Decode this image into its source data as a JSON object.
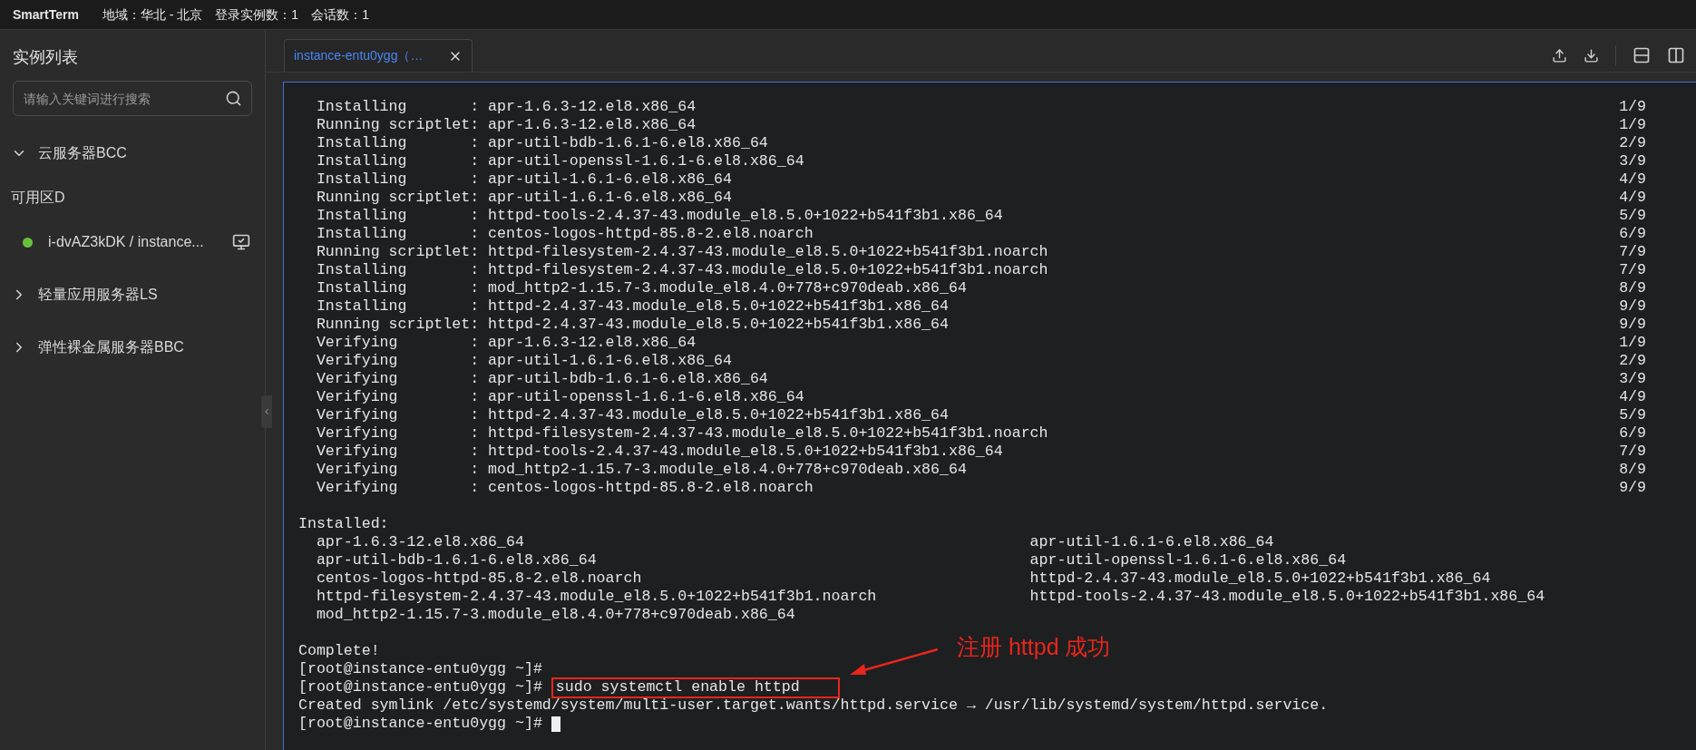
{
  "top_bar": {
    "app_name": "SmartTerm",
    "info": [
      "地域：华北 - 北京",
      "登录实例数：1",
      "会话数：1"
    ]
  },
  "sidebar": {
    "title": "实例列表",
    "search": {
      "placeholder": "请输入关键词进行搜索"
    },
    "groups": [
      {
        "label": "云服务器BCC",
        "expanded": true,
        "children": [
          {
            "label": "可用区D",
            "children": [
              {
                "label": "i-dvAZ3kDK / instance...",
                "color": "#67c23a"
              }
            ]
          }
        ]
      },
      {
        "label": "轻量应用服务器LS",
        "expanded": false
      },
      {
        "label": "弹性裸金属服务器BBC",
        "expanded": false
      }
    ]
  },
  "tabs": [
    {
      "label": "instance-entu0ygg（…",
      "selected": true
    }
  ],
  "terminal": {
    "lines": [
      {
        "kind": "step",
        "text": "  Installing       : apr-1.6.3-12.el8.x86_64",
        "progress": "1/9"
      },
      {
        "kind": "step",
        "text": "  Running scriptlet: apr-1.6.3-12.el8.x86_64",
        "progress": "1/9"
      },
      {
        "kind": "step",
        "text": "  Installing       : apr-util-bdb-1.6.1-6.el8.x86_64",
        "progress": "2/9"
      },
      {
        "kind": "step",
        "text": "  Installing       : apr-util-openssl-1.6.1-6.el8.x86_64",
        "progress": "3/9"
      },
      {
        "kind": "step",
        "text": "  Installing       : apr-util-1.6.1-6.el8.x86_64",
        "progress": "4/9"
      },
      {
        "kind": "step",
        "text": "  Running scriptlet: apr-util-1.6.1-6.el8.x86_64",
        "progress": "4/9"
      },
      {
        "kind": "step",
        "text": "  Installing       : httpd-tools-2.4.37-43.module_el8.5.0+1022+b541f3b1.x86_64",
        "progress": "5/9"
      },
      {
        "kind": "step",
        "text": "  Installing       : centos-logos-httpd-85.8-2.el8.noarch",
        "progress": "6/9"
      },
      {
        "kind": "step",
        "text": "  Running scriptlet: httpd-filesystem-2.4.37-43.module_el8.5.0+1022+b541f3b1.noarch",
        "progress": "7/9"
      },
      {
        "kind": "step",
        "text": "  Installing       : httpd-filesystem-2.4.37-43.module_el8.5.0+1022+b541f3b1.noarch",
        "progress": "7/9"
      },
      {
        "kind": "step",
        "text": "  Installing       : mod_http2-1.15.7-3.module_el8.4.0+778+c970deab.x86_64",
        "progress": "8/9"
      },
      {
        "kind": "step",
        "text": "  Installing       : httpd-2.4.37-43.module_el8.5.0+1022+b541f3b1.x86_64",
        "progress": "9/9"
      },
      {
        "kind": "step",
        "text": "  Running scriptlet: httpd-2.4.37-43.module_el8.5.0+1022+b541f3b1.x86_64",
        "progress": "9/9"
      },
      {
        "kind": "step",
        "text": "  Verifying        : apr-1.6.3-12.el8.x86_64",
        "progress": "1/9"
      },
      {
        "kind": "step",
        "text": "  Verifying        : apr-util-1.6.1-6.el8.x86_64",
        "progress": "2/9"
      },
      {
        "kind": "step",
        "text": "  Verifying        : apr-util-bdb-1.6.1-6.el8.x86_64",
        "progress": "3/9"
      },
      {
        "kind": "step",
        "text": "  Verifying        : apr-util-openssl-1.6.1-6.el8.x86_64",
        "progress": "4/9"
      },
      {
        "kind": "step",
        "text": "  Verifying        : httpd-2.4.37-43.module_el8.5.0+1022+b541f3b1.x86_64",
        "progress": "5/9"
      },
      {
        "kind": "step",
        "text": "  Verifying        : httpd-filesystem-2.4.37-43.module_el8.5.0+1022+b541f3b1.noarch",
        "progress": "6/9"
      },
      {
        "kind": "step",
        "text": "  Verifying        : httpd-tools-2.4.37-43.module_el8.5.0+1022+b541f3b1.x86_64",
        "progress": "7/9"
      },
      {
        "kind": "step",
        "text": "  Verifying        : mod_http2-1.15.7-3.module_el8.4.0+778+c970deab.x86_64",
        "progress": "8/9"
      },
      {
        "kind": "step",
        "text": "  Verifying        : centos-logos-httpd-85.8-2.el8.noarch",
        "progress": "9/9"
      },
      {
        "kind": "blank"
      },
      {
        "kind": "plain",
        "text": "Installed:"
      },
      {
        "kind": "columns",
        "cells": [
          "apr-1.6.3-12.el8.x86_64",
          "apr-util-1.6.1-6.el8.x86_64"
        ]
      },
      {
        "kind": "columns",
        "cells": [
          "apr-util-bdb-1.6.1-6.el8.x86_64",
          "apr-util-openssl-1.6.1-6.el8.x86_64"
        ]
      },
      {
        "kind": "columns",
        "cells": [
          "centos-logos-httpd-85.8-2.el8.noarch",
          "httpd-2.4.37-43.module_el8.5.0+1022+b541f3b1.x86_64"
        ]
      },
      {
        "kind": "columns",
        "cells": [
          "httpd-filesystem-2.4.37-43.module_el8.5.0+1022+b541f3b1.noarch",
          "httpd-tools-2.4.37-43.module_el8.5.0+1022+b541f3b1.x86_64"
        ]
      },
      {
        "kind": "columns",
        "cells": [
          "mod_http2-1.15.7-3.module_el8.4.0+778+c970deab.x86_64"
        ]
      },
      {
        "kind": "blank"
      },
      {
        "kind": "plain",
        "text": "Complete!"
      },
      {
        "kind": "prompt",
        "prompt": "[root@instance-entu0ygg ~]#",
        "cursor": false
      },
      {
        "kind": "prompt",
        "prompt": "[root@instance-entu0ygg ~]#",
        "command": "sudo systemctl enable httpd",
        "highlighted": true,
        "cursor": false
      },
      {
        "kind": "plain",
        "text": "Created symlink /etc/systemd/system/multi-user.target.wants/httpd.service → /usr/lib/systemd/system/httpd.service."
      },
      {
        "kind": "prompt",
        "prompt": "[root@instance-entu0ygg ~]#",
        "cursor": true
      }
    ]
  },
  "annotation": {
    "text": "注册 httpd 成功"
  }
}
